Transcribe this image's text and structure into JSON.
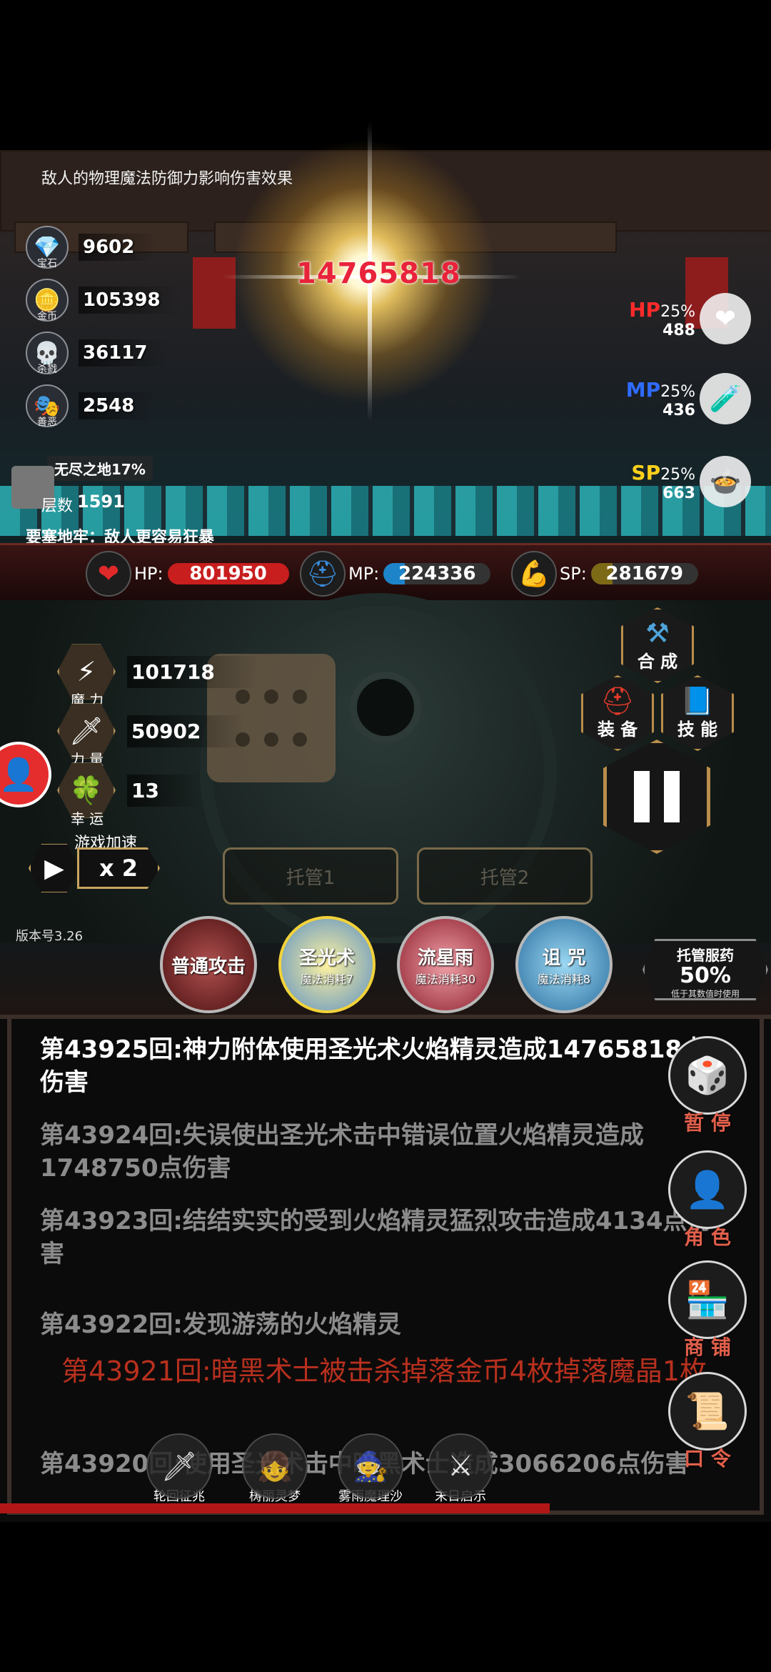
{
  "hint": "敌人的物理魔法防御力影响伤害效果",
  "resources": [
    {
      "icon": "gem-icon",
      "glyph": "💎",
      "sub": "宝石",
      "value": "9602"
    },
    {
      "icon": "coin-icon",
      "glyph": "🪙",
      "sub": "金币",
      "value": "105398"
    },
    {
      "icon": "skull-icon",
      "glyph": "💀",
      "sub": "杀戮",
      "value": "36117"
    },
    {
      "icon": "mask-icon",
      "glyph": "🎭",
      "sub": "善恶",
      "value": "2548"
    }
  ],
  "endless": "无尽之地17%",
  "floor": {
    "label": "层数",
    "value": "1591"
  },
  "dungeon_note": "要塞地牢：敌人更容易狂暴",
  "damage": "14765818",
  "potions": [
    {
      "type": "HP",
      "pct": "25%",
      "num": "488",
      "color": "#ff2b2b",
      "glyph": "❤"
    },
    {
      "type": "MP",
      "pct": "25%",
      "num": "436",
      "color": "#2f6bff",
      "glyph": "🧪"
    },
    {
      "type": "SP",
      "pct": "25%",
      "num": "663",
      "color": "#ffd11a",
      "glyph": "🍲"
    }
  ],
  "stats": {
    "hp": {
      "label": "HP:",
      "value": "801950",
      "color": "#c81e1e"
    },
    "mp": {
      "label": "MP:",
      "value": "224336",
      "color": "#1d84c9"
    },
    "sp": {
      "label": "SP:",
      "value": "281679",
      "color": "#7d6a16"
    }
  },
  "attributes": [
    {
      "icon": "lightning-icon",
      "glyph": "⚡",
      "label": "魔 力",
      "value": "101718"
    },
    {
      "icon": "sword-icon",
      "glyph": "🗡",
      "label": "力 量",
      "value": "50902"
    },
    {
      "icon": "clover-icon",
      "glyph": "🍀",
      "label": "幸 运",
      "value": "13"
    }
  ],
  "speed": {
    "label": "游戏加速",
    "multiplier": "x 2"
  },
  "auto": {
    "slot1": "托管1",
    "slot2": "托管2"
  },
  "menu": {
    "craft": "合 成",
    "equip": "装 备",
    "skill": "技 能"
  },
  "version": "版本号3.26",
  "skills": [
    {
      "name": "普通攻击",
      "cost": "",
      "bg": "#6a1d1d"
    },
    {
      "name": "圣光术",
      "cost": "魔法消耗7",
      "bg": "#b89a2a"
    },
    {
      "name": "流星雨",
      "cost": "魔法消耗30",
      "bg": "#b83a4a"
    },
    {
      "name": "诅 咒",
      "cost": "魔法消耗8",
      "bg": "#3a8cc7"
    }
  ],
  "auto_potion": {
    "title": "托管服药",
    "value": "50%",
    "note": "低于其数值时使用"
  },
  "logs": [
    {
      "text": "第43925回:神力附体使用圣光术火焰精灵造成14765818点伤害",
      "color": "#ffffff"
    },
    {
      "text": "第43924回:失误使出圣光术击中错误位置火焰精灵造成1748750点伤害",
      "color": "#8c8c8c"
    },
    {
      "text": "第43923回:结结实实的受到火焰精灵猛烈攻击造成4134点伤害",
      "color": "#8c8c8c"
    },
    {
      "text": "第43922回:发现游荡的火焰精灵",
      "color": "#8c8c8c"
    },
    {
      "text": "第43921回:暗黑术士被击杀掉落金币4枚掉落魔晶1枚",
      "color": "#b8301e"
    },
    {
      "text": "第43920回:使用圣光术击中暗黑术士造成3066206点伤害",
      "color": "#8c8c8c"
    }
  ],
  "side_buttons": [
    {
      "icon": "dice-icon",
      "glyph": "🎲",
      "label": "暂 停"
    },
    {
      "icon": "hooded-figure-icon",
      "glyph": "👤",
      "label": "角 色"
    },
    {
      "icon": "shop-icon",
      "glyph": "🏪",
      "label": "商 铺"
    },
    {
      "icon": "scroll-icon",
      "glyph": "📜",
      "label": "口 令"
    }
  ],
  "bottom_icons": [
    {
      "icon": "sword-crystal-icon",
      "glyph": "🗡",
      "label": "轮回征兆"
    },
    {
      "icon": "girl-icon",
      "glyph": "👧",
      "label": "梼丽灵梦"
    },
    {
      "icon": "witch-icon",
      "glyph": "🧙",
      "label": "雾雨魔理沙"
    },
    {
      "icon": "crossed-swords-icon",
      "glyph": "⚔",
      "label": "末日启示"
    }
  ]
}
